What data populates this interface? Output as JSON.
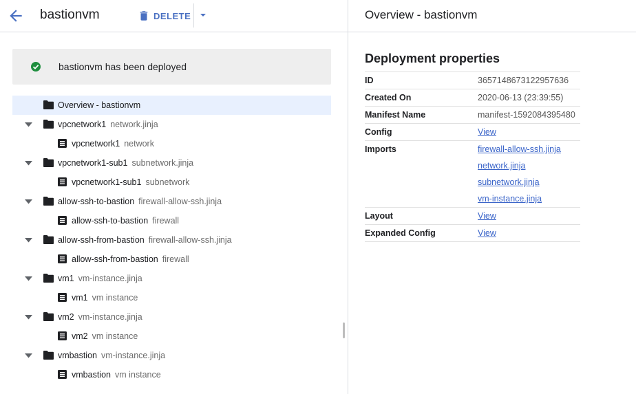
{
  "header": {
    "title": "bastionvm",
    "delete_label": "DELETE"
  },
  "banner": {
    "message": "bastionvm has been deployed"
  },
  "tree": {
    "overview": "Overview - bastionvm",
    "items": [
      {
        "name": "vpcnetwork1",
        "type": "network.jinja",
        "child": {
          "name": "vpcnetwork1",
          "type": "network"
        }
      },
      {
        "name": "vpcnetwork1-sub1",
        "type": "subnetwork.jinja",
        "child": {
          "name": "vpcnetwork1-sub1",
          "type": "subnetwork"
        }
      },
      {
        "name": "allow-ssh-to-bastion",
        "type": "firewall-allow-ssh.jinja",
        "child": {
          "name": "allow-ssh-to-bastion",
          "type": "firewall"
        }
      },
      {
        "name": "allow-ssh-from-bastion",
        "type": "firewall-allow-ssh.jinja",
        "child": {
          "name": "allow-ssh-from-bastion",
          "type": "firewall"
        }
      },
      {
        "name": "vm1",
        "type": "vm-instance.jinja",
        "child": {
          "name": "vm1",
          "type": "vm instance"
        }
      },
      {
        "name": "vm2",
        "type": "vm-instance.jinja",
        "child": {
          "name": "vm2",
          "type": "vm instance"
        }
      },
      {
        "name": "vmbastion",
        "type": "vm-instance.jinja",
        "child": {
          "name": "vmbastion",
          "type": "vm instance"
        }
      }
    ]
  },
  "detail": {
    "title": "Overview - bastionvm",
    "heading": "Deployment properties",
    "properties": {
      "id": {
        "label": "ID",
        "value": "3657148673122957636"
      },
      "created_on": {
        "label": "Created On",
        "value": "2020-06-13 (23:39:55)"
      },
      "manifest_name": {
        "label": "Manifest Name",
        "value": "manifest-1592084395480"
      },
      "config": {
        "label": "Config",
        "link": "View"
      },
      "imports": {
        "label": "Imports",
        "links": [
          "firewall-allow-ssh.jinja",
          "network.jinja",
          "subnetwork.jinja",
          "vm-instance.jinja"
        ]
      },
      "layout": {
        "label": "Layout",
        "link": "View"
      },
      "expanded_config": {
        "label": "Expanded Config",
        "link": "View"
      }
    }
  },
  "colors": {
    "accent": "#4a70c2",
    "link": "#3b65c9",
    "success": "#1e8e3e",
    "selected_row": "#e8f0fe",
    "banner_bg": "#eeeeee"
  },
  "icons": {
    "back": "arrow-back-icon",
    "delete": "trash-icon",
    "more": "caret-down-icon",
    "success": "check-circle-icon",
    "folder": "folder-icon",
    "document": "document-icon",
    "expand": "caret-down-icon"
  }
}
